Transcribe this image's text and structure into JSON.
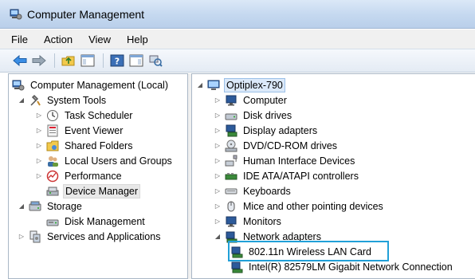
{
  "window": {
    "title": "Computer Management"
  },
  "menu": [
    "File",
    "Action",
    "View",
    "Help"
  ],
  "toolbar": {
    "icons": [
      "back-arrow-icon",
      "forward-arrow-icon",
      "up-folder-icon",
      "show-hide-tree-icon",
      "help-icon",
      "properties-icon",
      "scan-hardware-icon"
    ]
  },
  "left_tree": [
    {
      "label": "Computer Management (Local)",
      "icon": "computer-management-icon",
      "expander": ""
    },
    {
      "label": "System Tools",
      "icon": "system-tools-icon",
      "expander": "open"
    },
    {
      "label": "Task Scheduler",
      "icon": "clock-icon",
      "expander": "closed"
    },
    {
      "label": "Event Viewer",
      "icon": "event-viewer-icon",
      "expander": "closed"
    },
    {
      "label": "Shared Folders",
      "icon": "shared-folder-icon",
      "expander": "closed"
    },
    {
      "label": "Local Users and Groups",
      "icon": "users-icon",
      "expander": "closed"
    },
    {
      "label": "Performance",
      "icon": "performance-icon",
      "expander": "closed"
    },
    {
      "label": "Device Manager",
      "icon": "device-manager-icon",
      "expander": ""
    },
    {
      "label": "Storage",
      "icon": "storage-icon",
      "expander": "open"
    },
    {
      "label": "Disk Management",
      "icon": "disk-management-icon",
      "expander": ""
    },
    {
      "label": "Services and Applications",
      "icon": "services-icon",
      "expander": "closed"
    }
  ],
  "right_tree": [
    {
      "label": "Optiplex-790",
      "icon": "computer-icon",
      "expander": "open"
    },
    {
      "label": "Computer",
      "icon": "monitor-icon",
      "expander": "closed"
    },
    {
      "label": "Disk drives",
      "icon": "disk-drive-icon",
      "expander": "closed"
    },
    {
      "label": "Display adapters",
      "icon": "display-adapter-icon",
      "expander": "closed"
    },
    {
      "label": "DVD/CD-ROM drives",
      "icon": "dvd-drive-icon",
      "expander": "closed"
    },
    {
      "label": "Human Interface Devices",
      "icon": "hid-icon",
      "expander": "closed"
    },
    {
      "label": "IDE ATA/ATAPI controllers",
      "icon": "ide-controller-icon",
      "expander": "closed"
    },
    {
      "label": "Keyboards",
      "icon": "keyboard-icon",
      "expander": "closed"
    },
    {
      "label": "Mice and other pointing devices",
      "icon": "mouse-icon",
      "expander": "closed"
    },
    {
      "label": "Monitors",
      "icon": "monitor-icon",
      "expander": "closed"
    },
    {
      "label": "Network adapters",
      "icon": "network-adapter-icon",
      "expander": "open"
    },
    {
      "label": "802.11n Wireless LAN Card",
      "icon": "network-card-icon",
      "expander": ""
    },
    {
      "label": "Intel(R) 82579LM Gigabit Network Connection",
      "icon": "network-card-icon",
      "expander": ""
    }
  ],
  "colors": {
    "title_bar": "#c6d9f0",
    "callout_border": "#21a0d8",
    "selection": "#dbe9f9"
  }
}
